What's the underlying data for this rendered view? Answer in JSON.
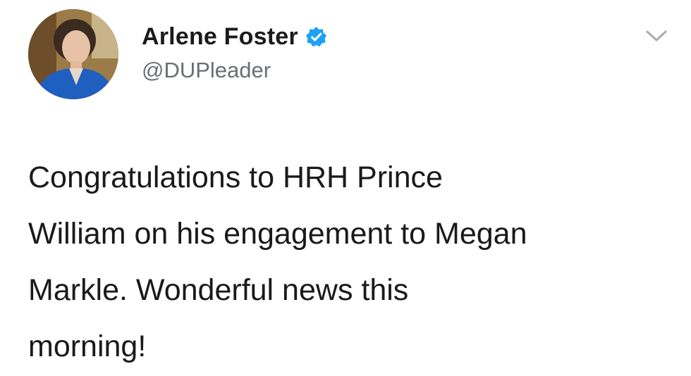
{
  "tweet": {
    "author": {
      "display_name": "Arlene Foster",
      "handle": "@DUPleader",
      "verified": true,
      "avatar_icon": "profile-photo",
      "verified_icon": "verified-badge-icon"
    },
    "text_lines": [
      "Congratulations to HRH Prince",
      "William on his engagement to Megan",
      "Markle. Wonderful news this",
      "morning!"
    ],
    "menu_icon": "chevron-down-icon"
  },
  "colors": {
    "verified_blue": "#1da1f2",
    "handle_gray": "#6b6f73",
    "text_black": "#1a1a1a",
    "jacket_blue": "#1f5fbf"
  }
}
